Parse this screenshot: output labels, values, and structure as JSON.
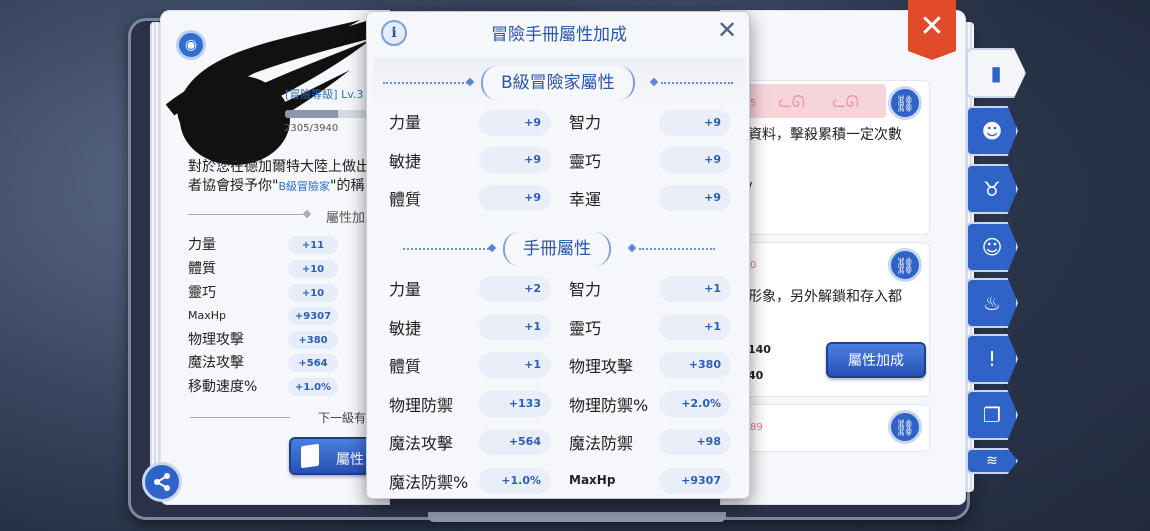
{
  "popup": {
    "title": "冒險手冊屬性加成",
    "sections": [
      {
        "label": "B級冒險家屬性",
        "rows": [
          [
            {
              "name": "力量",
              "value": "+9"
            },
            {
              "name": "智力",
              "value": "+9"
            }
          ],
          [
            {
              "name": "敏捷",
              "value": "+9"
            },
            {
              "name": "靈巧",
              "value": "+9"
            }
          ],
          [
            {
              "name": "體質",
              "value": "+9"
            },
            {
              "name": "幸運",
              "value": "+9"
            }
          ]
        ]
      },
      {
        "label": "手冊屬性",
        "rows": [
          [
            {
              "name": "力量",
              "value": "+2"
            },
            {
              "name": "智力",
              "value": "+1"
            }
          ],
          [
            {
              "name": "敏捷",
              "value": "+1"
            },
            {
              "name": "靈巧",
              "value": "+1"
            }
          ],
          [
            {
              "name": "體質",
              "value": "+1"
            },
            {
              "name": "物理攻擊",
              "value": "+380"
            }
          ],
          [
            {
              "name": "物理防禦",
              "value": "+133"
            },
            {
              "name": "物理防禦%",
              "value": "+2.0%"
            }
          ],
          [
            {
              "name": "魔法攻擊",
              "value": "+564"
            },
            {
              "name": "魔法防禦",
              "value": "+98"
            }
          ],
          [
            {
              "name": "魔法防禦%",
              "value": "+1.0%"
            },
            {
              "name": "MaxHp",
              "value": "+9307"
            }
          ]
        ]
      }
    ]
  },
  "left_page": {
    "rank_label": "[冒險等級] Lv.3",
    "xp_text": "2305/3940",
    "xp_fraction": 0.585,
    "desc_line1": "對於您在德加爾特大陸上做出",
    "desc_line2_a": "者協會授予你\"",
    "desc_line2_hi": "B級冒險家",
    "desc_line2_b": "\"的稱",
    "section_label": "屬性加成",
    "stats": [
      {
        "name": "力量",
        "value": "+11"
      },
      {
        "name": "體質",
        "value": "+10"
      },
      {
        "name": "靈巧",
        "value": "+10"
      },
      {
        "name": "MaxHp",
        "value": "+9307"
      },
      {
        "name": "物理攻擊",
        "value": "+380"
      },
      {
        "name": "魔法攻擊",
        "value": "+564"
      },
      {
        "name": "移動速度%",
        "value": "+1.0%"
      }
    ],
    "next_label": "下一級有",
    "button_label": "屬性"
  },
  "right_page": {
    "card1_num": "5",
    "card1_text": "資料，擊殺累積一定次數",
    "card1_extra": "/",
    "card2_num": "0",
    "card2_text": "形象，另外解鎖和存入都",
    "card2_line2": "140",
    "card2_line3": "40",
    "attr_button": "屬性加成",
    "card3_num": "89"
  },
  "colors": {
    "accent": "#2f63c7",
    "close": "#e24a2a",
    "value_text": "#2b5fb3"
  }
}
